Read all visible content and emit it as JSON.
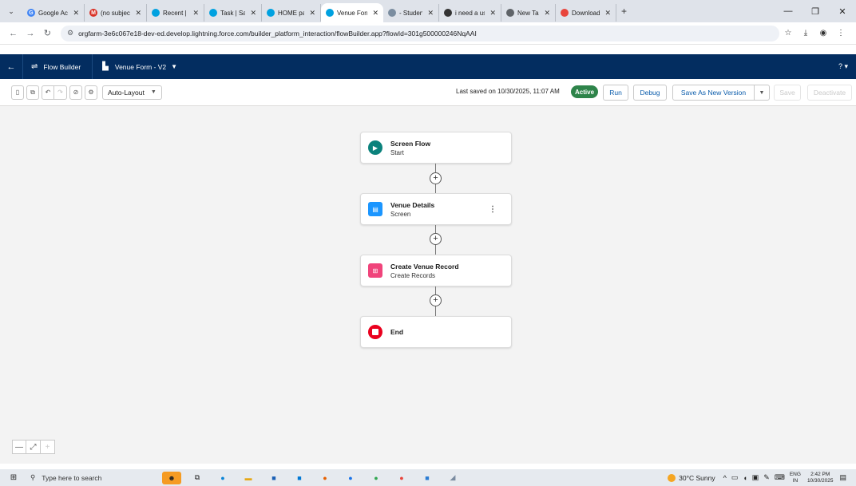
{
  "browser": {
    "tabs": [
      {
        "title": "Google Acc",
        "fav": "G",
        "color": "#4285f4",
        "active": false
      },
      {
        "title": "(no subject)",
        "fav": "M",
        "color": "#d93025",
        "active": false
      },
      {
        "title": "Recent | Re",
        "fav": "",
        "color": "#00a1e0",
        "active": false
      },
      {
        "title": "Task | Sales",
        "fav": "",
        "color": "#00a1e0",
        "active": false
      },
      {
        "title": "HOME page",
        "fav": "",
        "color": "#00a1e0",
        "active": false
      },
      {
        "title": "Venue Form",
        "fav": "",
        "color": "#00a1e0",
        "active": true
      },
      {
        "title": "- Student",
        "fav": "",
        "color": "#7b8da0",
        "active": false
      },
      {
        "title": "i need a use",
        "fav": "",
        "color": "#333333",
        "active": false
      },
      {
        "title": "New Tab",
        "fav": "",
        "color": "#5f6368",
        "active": false
      },
      {
        "title": "Download f",
        "fav": "",
        "color": "#e8453c",
        "active": false
      }
    ],
    "url": "orgfarm-3e6c067e18-dev-ed.develop.lightning.force.com/builder_platform_interaction/flowBuilder.app?flowId=301g500000246NqAAI"
  },
  "header": {
    "app_name": "Flow Builder",
    "flow_name": "Venue Form - V2",
    "help": "?"
  },
  "toolbar": {
    "layout_mode": "Auto-Layout",
    "last_saved": "Last saved on 10/30/2025, 11:07 AM",
    "status_badge": "Active",
    "run_label": "Run",
    "debug_label": "Debug",
    "save_as_new_label": "Save As New Version",
    "save_label": "Save",
    "deactivate_label": "Deactivate"
  },
  "flow": {
    "nodes": [
      {
        "title": "Screen Flow",
        "subtitle": "Start",
        "icon": "play-icon",
        "color": "#0b827c"
      },
      {
        "title": "Venue Details",
        "subtitle": "Screen",
        "icon": "screen-icon",
        "color": "#1b96ff"
      },
      {
        "title": "Create Venue Record",
        "subtitle": "Create Records",
        "icon": "record-create-icon",
        "color": "#f0447b"
      },
      {
        "title": "End",
        "subtitle": "",
        "icon": "stop-icon",
        "color": "#ea001e"
      }
    ]
  },
  "taskbar": {
    "search_placeholder": "Type here to search",
    "weather": "30°C  Sunny",
    "lang_top": "ENG",
    "lang_bottom": "IN",
    "time": "2:42 PM",
    "date": "10/30/2025"
  }
}
